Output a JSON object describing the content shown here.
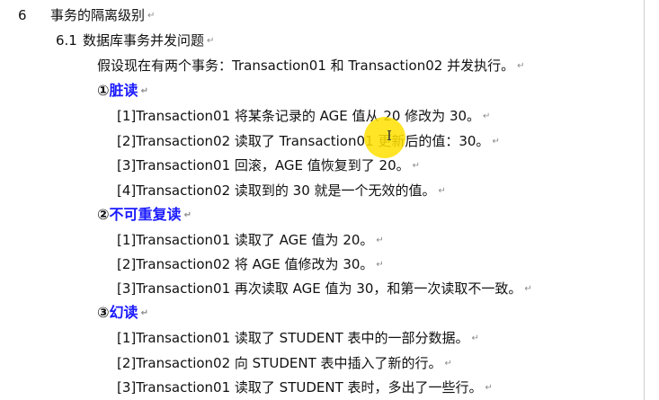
{
  "heading": {
    "number": "6",
    "title": "事务的隔离级别"
  },
  "subheading": {
    "number": "6.1",
    "title": "数据库事务并发问题"
  },
  "intro": "假设现在有两个事务：Transaction01 和 Transaction02 并发执行。",
  "paragraph_mark": "↵",
  "sections": [
    {
      "marker": "①",
      "label": "脏读",
      "items": [
        "[1]Transaction01 将某条记录的 AGE 值从 20 修改为 30。",
        "[2]Transaction02 读取了 Transaction01 更新后的值：30。",
        "[3]Transaction01 回滚，AGE 值恢复到了 20。",
        "[4]Transaction02 读取到的 30 就是一个无效的值。"
      ]
    },
    {
      "marker": "②",
      "label": "不可重复读",
      "items": [
        "[1]Transaction01 读取了 AGE 值为 20。",
        "[2]Transaction02 将 AGE 值修改为 30。",
        "[3]Transaction01 再次读取 AGE 值为 30，和第一次读取不一致。"
      ]
    },
    {
      "marker": "③",
      "label": "幻读",
      "items": [
        "[1]Transaction01 读取了 STUDENT 表中的一部分数据。",
        "[2]Transaction02 向 STUDENT 表中插入了新的行。",
        "[3]Transaction01 读取了 STUDENT 表时，多出了一些行。"
      ]
    }
  ]
}
